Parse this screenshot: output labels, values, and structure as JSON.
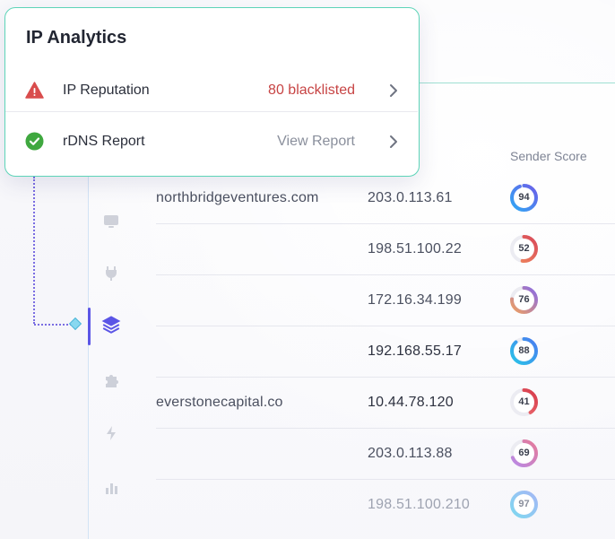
{
  "card": {
    "title": "IP Analytics",
    "rows": [
      {
        "label": "IP Reputation",
        "value": "80 blacklisted",
        "value_color": "#c74444",
        "icon": "warning-triangle-icon",
        "icon_color": "#d94c4c"
      },
      {
        "label": "rDNS Report",
        "value": "View Report",
        "value_color": "#8a8f9c",
        "icon": "check-circle-icon",
        "icon_color": "#3fa83f"
      }
    ]
  },
  "table": {
    "sender_score_header": "Sender Score",
    "rows": [
      {
        "domain": "northbridgeventures.com",
        "ip": "203.0.113.61",
        "score": 94,
        "ring_color": "#2fa8f5",
        "ring_color2": "#6c5fe8"
      },
      {
        "domain": "",
        "ip": "198.51.100.22",
        "score": 52,
        "ring_color": "#f08a5d",
        "ring_color2": "#d94a5a"
      },
      {
        "domain": "",
        "ip": "172.16.34.199",
        "score": 76,
        "ring_color": "#f0a060",
        "ring_color2": "#8a6be6"
      },
      {
        "domain": "",
        "ip": "192.168.55.17",
        "score": 88,
        "ring_color": "#29c4e8",
        "ring_color2": "#4a7cf0"
      },
      {
        "domain": "everstonecapital.co",
        "ip": "10.44.78.120",
        "score": 41,
        "ring_color": "#f27a7a",
        "ring_color2": "#d63a4a"
      },
      {
        "domain": "",
        "ip": "203.0.113.88",
        "score": 69,
        "ring_color": "#b88ae8",
        "ring_color2": "#e57a9a"
      },
      {
        "domain": "",
        "ip": "198.51.100.210",
        "score": 97,
        "ring_color": "#7fd8f0",
        "ring_color2": "#a4b8f5"
      }
    ]
  },
  "sidebar": {
    "icons": [
      "monitor-icon",
      "plug-icon",
      "layers-icon",
      "puzzle-icon",
      "bolt-icon",
      "bar-chart-icon"
    ],
    "active": "layers-icon",
    "accent": "#5b55e6"
  }
}
